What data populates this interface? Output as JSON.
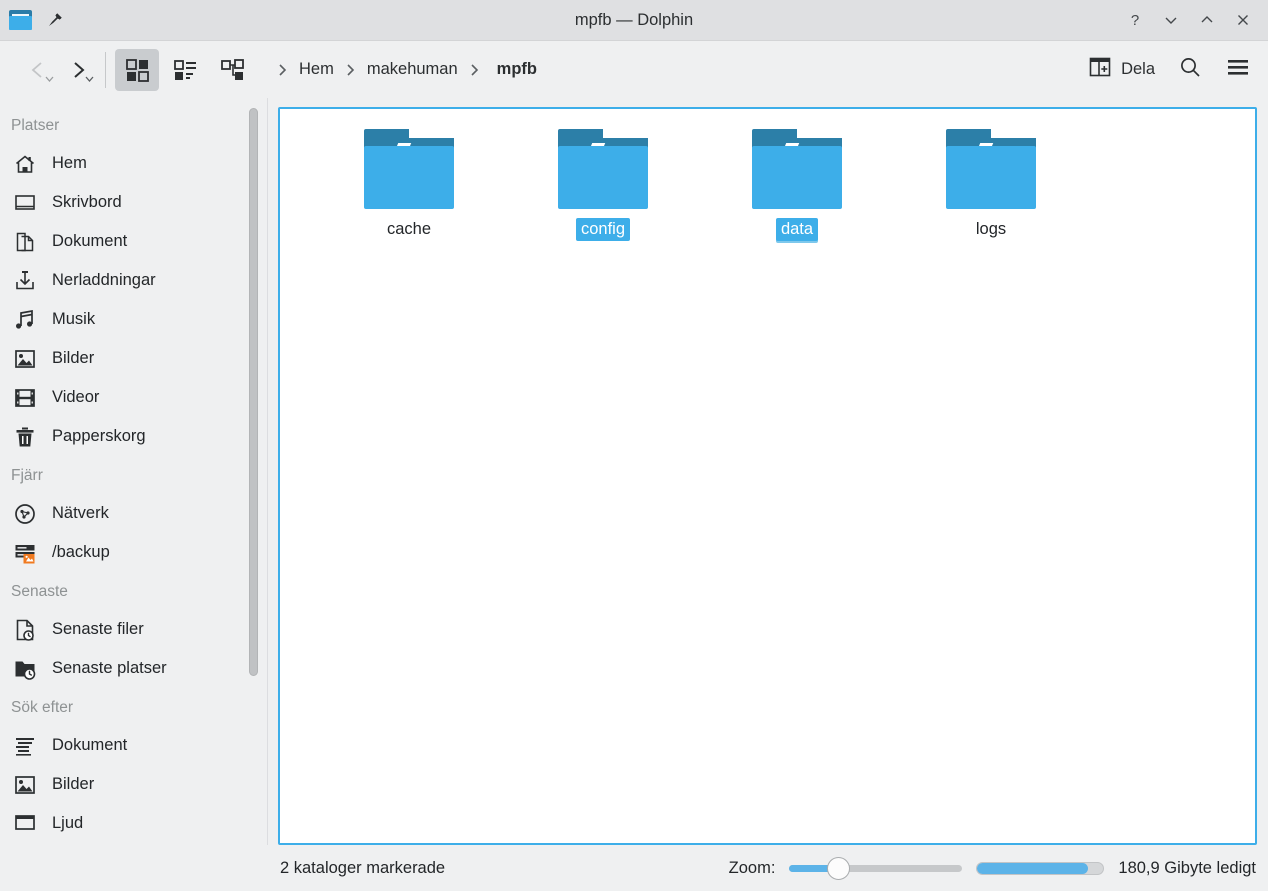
{
  "window": {
    "title": "mpfb — Dolphin",
    "app_icon": "folder-icon",
    "pin_icon": "pin-icon",
    "controls": [
      {
        "name": "help",
        "glyph": "?"
      },
      {
        "name": "minimize",
        "glyph": "⌄"
      },
      {
        "name": "maximize",
        "glyph": "⌃"
      },
      {
        "name": "close",
        "glyph": "✕"
      }
    ]
  },
  "toolbar": {
    "back_label": "",
    "forward_label": "",
    "view_modes": [
      {
        "name": "icons-view",
        "active": true
      },
      {
        "name": "compact-view",
        "active": false
      },
      {
        "name": "details-view",
        "active": false
      }
    ],
    "breadcrumb": [
      {
        "label": "Hem",
        "current": false
      },
      {
        "label": "makehuman",
        "current": false
      },
      {
        "label": "mpfb",
        "current": true
      }
    ],
    "share_label": "Dela",
    "search_icon": "search-icon",
    "menu_icon": "hamburger-menu-icon"
  },
  "sidebar": {
    "sections": [
      {
        "title": "Platser",
        "items": [
          {
            "label": "Hem",
            "icon": "home-icon"
          },
          {
            "label": "Skrivbord",
            "icon": "desktop-icon"
          },
          {
            "label": "Dokument",
            "icon": "documents-icon"
          },
          {
            "label": "Nerladdningar",
            "icon": "download-icon"
          },
          {
            "label": "Musik",
            "icon": "music-icon"
          },
          {
            "label": "Bilder",
            "icon": "image-icon"
          },
          {
            "label": "Videor",
            "icon": "video-icon"
          },
          {
            "label": "Papperskorg",
            "icon": "trash-icon"
          }
        ]
      },
      {
        "title": "Fjärr",
        "items": [
          {
            "label": "Nätverk",
            "icon": "network-icon"
          },
          {
            "label": "/backup",
            "icon": "remote-disk-icon"
          }
        ]
      },
      {
        "title": "Senaste",
        "items": [
          {
            "label": "Senaste filer",
            "icon": "recent-file-icon"
          },
          {
            "label": "Senaste platser",
            "icon": "recent-folder-icon"
          }
        ]
      },
      {
        "title": "Sök efter",
        "items": [
          {
            "label": "Dokument",
            "icon": "search-documents-icon"
          },
          {
            "label": "Bilder",
            "icon": "search-images-icon"
          },
          {
            "label": "Ljud",
            "icon": "search-audio-icon"
          }
        ]
      }
    ]
  },
  "content": {
    "items": [
      {
        "label": "cache",
        "icon": "folder-icon",
        "selected": false,
        "focused": false
      },
      {
        "label": "config",
        "icon": "folder-icon",
        "selected": true,
        "focused": false
      },
      {
        "label": "data",
        "icon": "folder-icon",
        "selected": true,
        "focused": true
      },
      {
        "label": "logs",
        "icon": "folder-icon",
        "selected": false,
        "focused": false
      }
    ]
  },
  "statusbar": {
    "selection_text": "2 kataloger markerade",
    "zoom_label": "Zoom:",
    "zoom_value": 22,
    "free_space_text": "180,9 Gibyte ledigt",
    "used_space_percent": 88
  },
  "colors": {
    "accent": "#3daee9",
    "folder_body": "#3daee9",
    "folder_tab": "#2c7fa8",
    "window_bg": "#eff0f1",
    "titlebar_bg": "#dfe0e2",
    "text": "#232629"
  }
}
